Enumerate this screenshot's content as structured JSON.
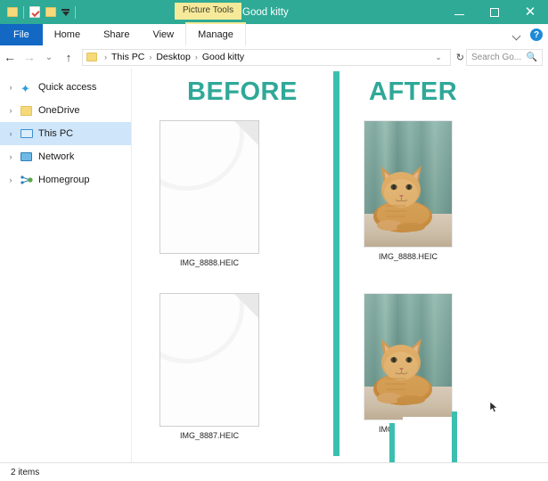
{
  "window": {
    "title": "Good kitty",
    "contextual_tab_group": "Picture Tools",
    "quick_access": [
      {
        "name": "folder-icon",
        "label": "Properties"
      },
      {
        "name": "properties-icon",
        "label": "Properties"
      },
      {
        "name": "new-folder-icon",
        "label": "New folder"
      },
      {
        "name": "customize-caret-icon",
        "label": "Customize Quick Access Toolbar"
      }
    ],
    "controls": {
      "minimize": "–",
      "maximize": "□",
      "close": "✕"
    },
    "accent_color": "#2eaa96",
    "contextual_color": "#f6ea9a"
  },
  "ribbon": {
    "tabs": [
      {
        "label": "File"
      },
      {
        "label": "Home"
      },
      {
        "label": "Share"
      },
      {
        "label": "View"
      },
      {
        "label": "Manage"
      }
    ],
    "minimize_ribbon": "⌄",
    "help": "?"
  },
  "address_bar": {
    "back": "←",
    "forward": "→",
    "history": "⌄",
    "up": "↑",
    "breadcrumbs": [
      "This PC",
      "Desktop",
      "Good kitty"
    ],
    "separator": "›",
    "dropdown": "⌄",
    "refresh": "↻",
    "search_placeholder": "Search Go...",
    "search_value": "",
    "search_icon": "⌕"
  },
  "sidebar": {
    "items": [
      {
        "label": "Quick access",
        "icon": "star-icon",
        "expand": "›",
        "selected": false
      },
      {
        "label": "OneDrive",
        "icon": "onedrive-folder-icon",
        "expand": "›",
        "selected": false
      },
      {
        "label": "This PC",
        "icon": "this-pc-icon",
        "expand": "›",
        "selected": true
      },
      {
        "label": "Network",
        "icon": "network-icon",
        "expand": "›",
        "selected": false
      },
      {
        "label": "Homegroup",
        "icon": "homegroup-icon",
        "expand": "›",
        "selected": false
      }
    ]
  },
  "content": {
    "headings": {
      "before": "BEFORE",
      "after": "AFTER"
    },
    "heading_color": "#2fa898",
    "divider_color": "#3bbfb0",
    "before_files": [
      {
        "name": "IMG_8888.HEIC",
        "icon": "generic-file-icon"
      },
      {
        "name": "IMG_8887.HEIC",
        "icon": "generic-file-icon"
      }
    ],
    "after_files": [
      {
        "name": "IMG_8888.HEIC",
        "icon": "photo-thumbnail"
      },
      {
        "name": "IMG_8887.HEIC",
        "icon": "photo-thumbnail"
      }
    ]
  },
  "status_bar": {
    "item_count": "2 items"
  }
}
